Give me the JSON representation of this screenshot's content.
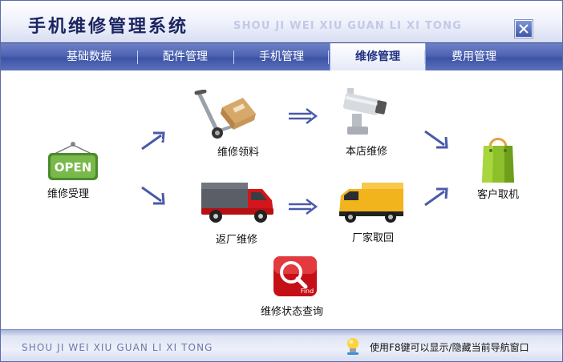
{
  "app": {
    "title": "手机维修管理系统",
    "subtitle": "SHOU JI WEI XIU GUAN LI XI TONG"
  },
  "nav": {
    "items": [
      {
        "label": "基础数据"
      },
      {
        "label": "配件管理"
      },
      {
        "label": "手机管理"
      },
      {
        "label": "维修管理"
      },
      {
        "label": "费用管理"
      }
    ],
    "active": "维修管理"
  },
  "workflow": {
    "accept": {
      "label": "维修受理",
      "icon": "open-sign-icon",
      "sign_text": "OPEN"
    },
    "parts": {
      "label": "维修领料",
      "icon": "hand-truck-icon"
    },
    "inhouse": {
      "label": "本店维修",
      "icon": "security-camera-icon"
    },
    "return": {
      "label": "返厂维修",
      "icon": "red-truck-icon"
    },
    "factory": {
      "label": "厂家取回",
      "icon": "yellow-truck-icon"
    },
    "pickup": {
      "label": "客户取机",
      "icon": "shopping-bag-icon"
    },
    "status": {
      "label": "维修状态查询",
      "icon": "magnifier-find-icon",
      "badge_text": "Find"
    }
  },
  "footer": {
    "brand": "SHOU JI WEI XIU GUAN LI XI TONG",
    "hint": "使用F8键可以显示/隐藏当前导航窗口"
  },
  "colors": {
    "nav_bg": "#4e64b3",
    "title_text": "#1b2560",
    "arrow": "#4a5aa8"
  }
}
